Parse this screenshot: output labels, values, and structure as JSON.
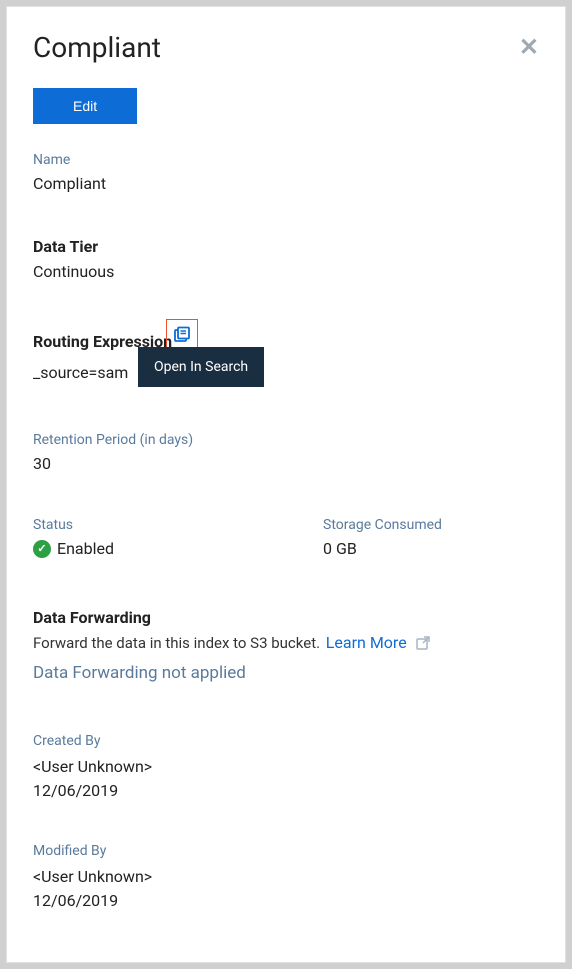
{
  "header": {
    "title": "Compliant",
    "edit_label": "Edit"
  },
  "fields": {
    "name": {
      "label": "Name",
      "value": "Compliant"
    },
    "data_tier": {
      "label": "Data Tier",
      "value": "Continuous"
    },
    "routing": {
      "label": "Routing Expression",
      "value": "_source=sam",
      "tooltip": "Open In Search"
    },
    "retention": {
      "label": "Retention Period (in days)",
      "value": "30"
    },
    "status": {
      "label": "Status",
      "value": "Enabled"
    },
    "storage": {
      "label": "Storage Consumed",
      "value": "0 GB"
    }
  },
  "forwarding": {
    "heading": "Data Forwarding",
    "description": "Forward the data in this index to S3 bucket.",
    "learn_more": "Learn More",
    "status": "Data Forwarding not applied"
  },
  "created": {
    "label": "Created By",
    "user": "<User Unknown>",
    "date": "12/06/2019"
  },
  "modified": {
    "label": "Modified By",
    "user": "<User Unknown>",
    "date": "12/06/2019"
  }
}
